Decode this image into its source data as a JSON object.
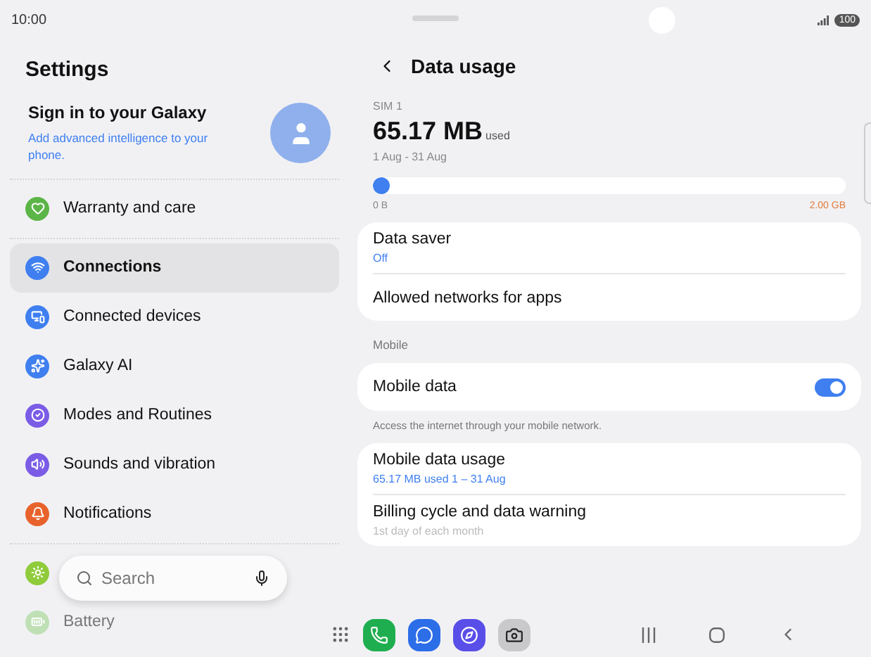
{
  "status_bar": {
    "time": "10:00",
    "battery": "100"
  },
  "settings": {
    "title": "Settings",
    "account": {
      "title": "Sign in to your Galaxy",
      "subtitle": "Add advanced intelligence to your phone."
    },
    "groups": [
      [
        {
          "label": "Warranty and care",
          "color": "#5cb547",
          "selected": false
        }
      ],
      [
        {
          "label": "Connections",
          "color": "#3f7ff0",
          "selected": true
        },
        {
          "label": "Connected devices",
          "color": "#3f7ff0",
          "selected": false
        },
        {
          "label": "Galaxy AI",
          "color": "#3f7ff0",
          "selected": false
        },
        {
          "label": "Modes and Routines",
          "color": "#7a5ce6",
          "selected": false
        },
        {
          "label": "Sounds and vibration",
          "color": "#7a5ce6",
          "selected": false
        },
        {
          "label": "Notifications",
          "color": "#e8622c",
          "selected": false
        }
      ],
      [
        {
          "color": "#8fcb3a",
          "selected": false
        },
        {
          "label": "Battery",
          "color": "#bfe0b5",
          "selected": false
        }
      ]
    ]
  },
  "search": {
    "placeholder": "Search"
  },
  "data_usage": {
    "title": "Data usage",
    "sim": "SIM 1",
    "amount": "65.17 MB",
    "unit": "used",
    "period": "1 Aug - 31 Aug",
    "level": 0.035,
    "min_label": "0 B",
    "max_label": "2.00 GB",
    "cards": [
      {
        "rows": [
          {
            "title": "Data saver",
            "subtitle": "Off"
          },
          {
            "title": "Allowed networks for apps"
          }
        ]
      },
      {
        "heading": "Mobile",
        "hint": "Access the internet through your mobile network.",
        "rows": [
          {
            "title": "Mobile data",
            "on": true
          }
        ]
      },
      {
        "rows": [
          {
            "title": "Mobile data usage",
            "subtitle": "65.17 MB used 1 – 31 Aug"
          },
          {
            "title": "Billing cycle and data warning",
            "note": "1st day of each month"
          }
        ]
      }
    ]
  },
  "dock": [
    {
      "color": "#1fae4f"
    },
    {
      "color": "#2c6de8"
    },
    {
      "color": "#5a4ee8"
    },
    {
      "color": "#c9c9cc"
    }
  ]
}
